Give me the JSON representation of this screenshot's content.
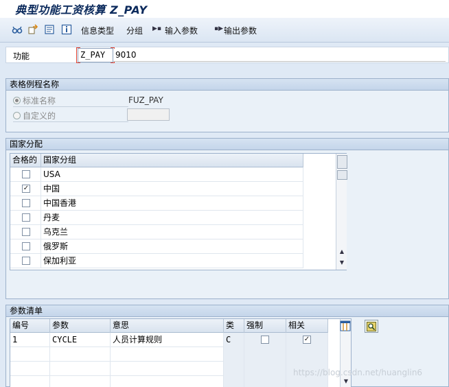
{
  "window": {
    "title": "典型功能工资核算 Z_PAY"
  },
  "toolbar": {
    "icons": [
      "glasses-icon",
      "export-icon",
      "document-icon",
      "info-icon"
    ],
    "info_type_label": "信息类型",
    "grouping_label": "分组",
    "input_params_label": "输入参数",
    "output_params_label": "输出参数"
  },
  "function": {
    "label": "功能",
    "value": "Z_PAY",
    "description": "9010"
  },
  "table_routine": {
    "title": "表格例程名称",
    "standard_label": "标准名称",
    "standard_value": "FUZ_PAY",
    "standard_selected": true,
    "custom_label": "自定义的",
    "custom_selected": false,
    "custom_value": ""
  },
  "country_assignment": {
    "title": "国家分配",
    "columns": [
      "合格的",
      "国家分组"
    ],
    "rows": [
      {
        "checked": false,
        "country": "USA"
      },
      {
        "checked": true,
        "country": "中国"
      },
      {
        "checked": false,
        "country": "中国香港"
      },
      {
        "checked": false,
        "country": "丹麦"
      },
      {
        "checked": false,
        "country": "乌克兰"
      },
      {
        "checked": false,
        "country": "俄罗斯"
      },
      {
        "checked": false,
        "country": "保加利亚"
      }
    ]
  },
  "parameter_list": {
    "title": "参数清单",
    "columns": [
      "编号",
      "参数",
      "意思",
      "类",
      "强制",
      "相关"
    ],
    "rows": [
      {
        "no": "1",
        "param": "CYCLE",
        "meaning": "人员计算规则",
        "class": "C",
        "mandatory": false,
        "related": true
      }
    ]
  },
  "watermark": "https://blog.csdn.net/huanglin6"
}
